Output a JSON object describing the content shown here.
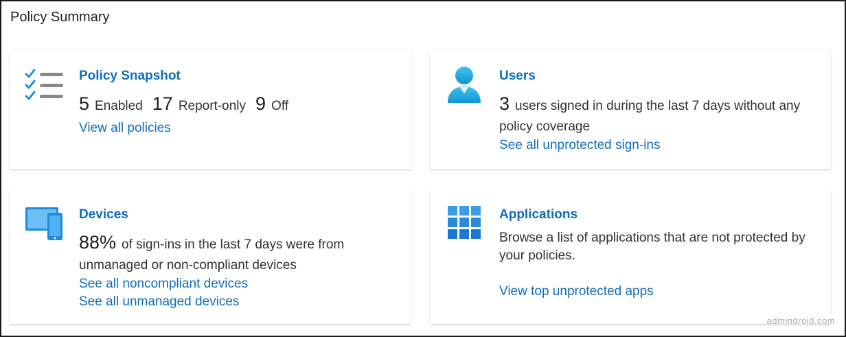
{
  "page": {
    "title": "Policy Summary"
  },
  "cards": {
    "policy_snapshot": {
      "title": "Policy Snapshot",
      "icon": "checklist-icon",
      "enabled_count": "5",
      "enabled_label": "Enabled",
      "report_only_count": "17",
      "report_only_label": "Report-only",
      "off_count": "9",
      "off_label": "Off",
      "link": "View all policies"
    },
    "users": {
      "title": "Users",
      "icon": "user-icon",
      "count": "3",
      "text_line1": "users signed in during the last 7 days without any",
      "text_line2": "policy coverage",
      "link": "See all unprotected sign-ins"
    },
    "devices": {
      "title": "Devices",
      "icon": "devices-icon",
      "percent": "88%",
      "text_line1": "of sign-ins in the last 7 days were from",
      "text_line2": "unmanaged or non-compliant devices",
      "link_noncompliant": "See all noncompliant devices",
      "link_unmanaged": "See all unmanaged devices"
    },
    "applications": {
      "title": "Applications",
      "icon": "app-grid-icon",
      "text_line1": "Browse a list of applications that are not protected by",
      "text_line2": "your policies.",
      "link": "View top unprotected apps"
    }
  },
  "watermark": "admindroid.com",
  "colors": {
    "link": "#0f6cbd",
    "icon_blue": "#1e8be0",
    "icon_grey": "#8a8886"
  }
}
